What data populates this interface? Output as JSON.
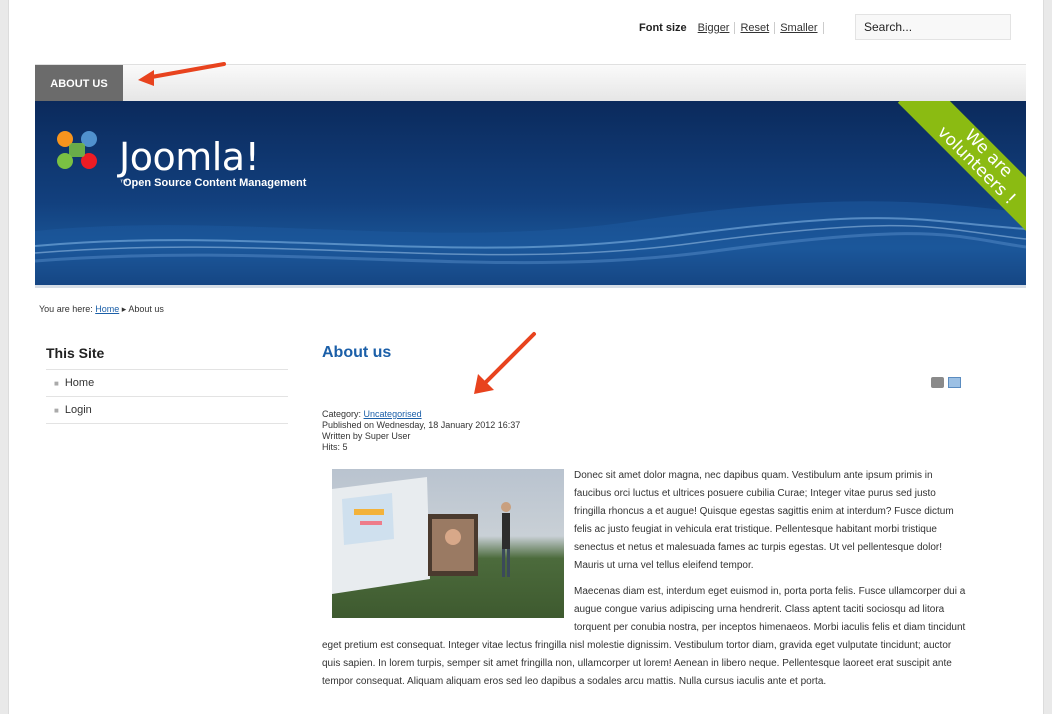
{
  "topbar": {
    "font_size_label": "Font size",
    "bigger": "Bigger",
    "reset": "Reset",
    "smaller": "Smaller",
    "search_placeholder": "Search..."
  },
  "nav": {
    "active_tab": "ABOUT US"
  },
  "banner": {
    "logo_text": "Joomla!",
    "logo_tm": "™",
    "tagline": "Open Source Content Management",
    "ribbon_line1": "We are",
    "ribbon_line2": "volunteers !"
  },
  "breadcrumb": {
    "prefix": "You are here:",
    "home": "Home",
    "separator": "▸",
    "current": "About us"
  },
  "sidebar": {
    "title": "This Site",
    "items": [
      {
        "label": "Home"
      },
      {
        "label": "Login"
      }
    ]
  },
  "article": {
    "title": "About us",
    "category_label": "Category:",
    "category_link": "Uncategorised",
    "published": "Published on Wednesday, 18 January 2012 16:37",
    "written_by": "Written by Super User",
    "hits": "Hits: 5",
    "paragraph1": "Donec sit amet dolor magna, nec dapibus quam. Vestibulum ante ipsum primis in faucibus orci luctus et ultrices posuere cubilia Curae; Integer vitae purus sed justo fringilla rhoncus a et augue! Quisque egestas sagittis enim at interdum? Fusce dictum felis ac justo feugiat in vehicula erat tristique. Pellentesque habitant morbi tristique senectus et netus et malesuada fames ac turpis egestas. Ut vel pellentesque dolor! Mauris ut urna vel tellus eleifend tempor.",
    "paragraph2": "Maecenas diam est, interdum eget euismod in, porta porta felis. Fusce ullamcorper dui a augue congue varius adipiscing urna hendrerit. Class aptent taciti sociosqu ad litora torquent per conubia nostra, per inceptos himenaeos. Morbi iaculis felis et diam tincidunt eget pretium est consequat. Integer vitae lectus fringilla nisl molestie dignissim. Vestibulum tortor diam, gravida eget vulputate tincidunt; auctor quis sapien. In lorem turpis, semper sit amet fringilla non, ullamcorper ut lorem! Aenean in libero neque. Pellentesque laoreet erat suscipit ante tempor consequat. Aliquam aliquam eros sed leo dapibus a sodales arcu mattis. Nulla cursus iaculis ante et porta."
  },
  "colors": {
    "accent_blue": "#1b5fa8",
    "banner_navy": "#0b2a5c",
    "ribbon_green": "#8bbb12",
    "arrow_red": "#e8431e"
  }
}
